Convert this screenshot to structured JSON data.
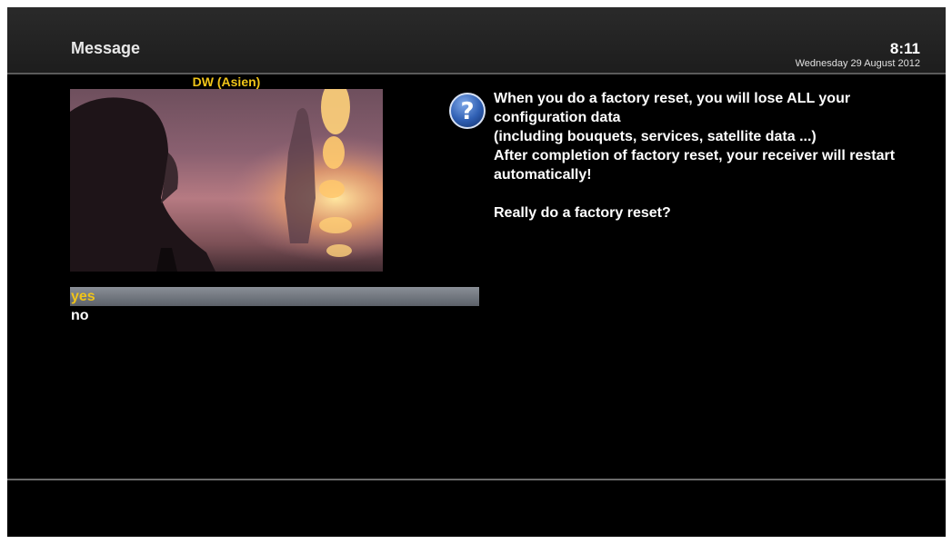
{
  "header": {
    "title": "Message",
    "time": "8:11",
    "date": "Wednesday 29 August 2012"
  },
  "preview": {
    "channel_name": "DW (Asien)"
  },
  "message": {
    "icon": "question-icon",
    "text": "When you do a factory reset, you will lose ALL your configuration data\n(including bouquets, services, satellite data ...)\nAfter completion of factory reset, your receiver will restart automatically!\n\nReally do a factory reset?"
  },
  "choices": [
    {
      "label": "yes",
      "selected": true
    },
    {
      "label": "no",
      "selected": false
    }
  ],
  "colors": {
    "highlight_text": "#f0c419",
    "icon_blue": "#2f5fb3"
  }
}
